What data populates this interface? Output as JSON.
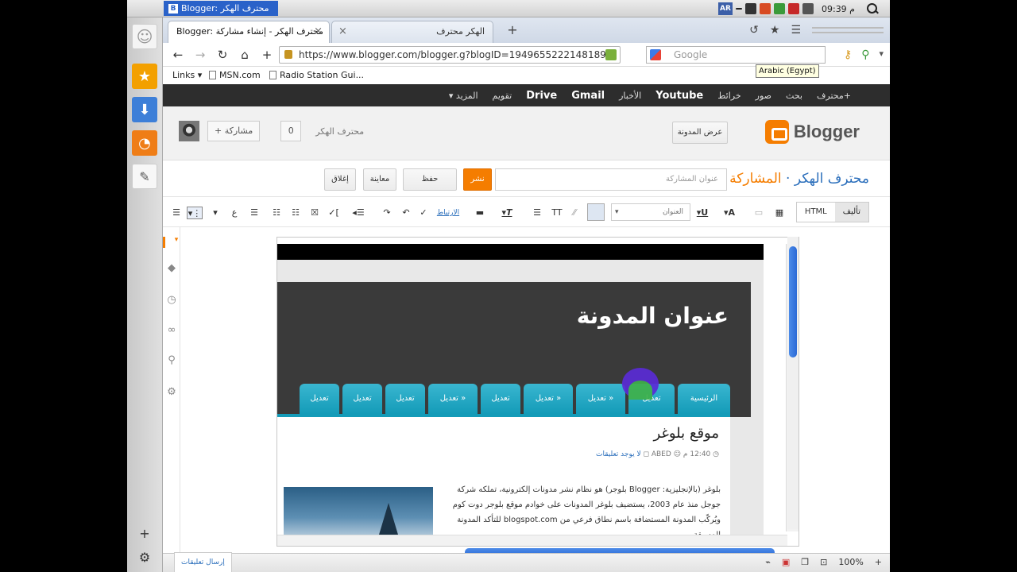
{
  "system": {
    "active_app_title": "Blogger: محترف الهكر ...",
    "language_indicator": "AR",
    "time": "م 09:39"
  },
  "launcher": {
    "icons": [
      "smiley-icon",
      "star-icon",
      "download-icon",
      "rss-icon",
      "notepad-icon",
      "add-icon",
      "settings-icon"
    ]
  },
  "browser": {
    "tabs": [
      {
        "title": "Blogger: محترف الهكر - إنشاء مشاركة",
        "active": true
      },
      {
        "title": "الهكر محترف",
        "active": false
      }
    ],
    "new_tab_symbol": "+",
    "url": "https://www.blogger.com/blogger.g?blogID=19496552221481899",
    "search_placeholder": "Google",
    "language_tooltip": "Arabic (Egypt)",
    "bookmarks": [
      "Links ▾",
      "MSN.com",
      "Radio Station Gui..."
    ]
  },
  "google_bar": {
    "items": [
      "+محترف",
      "بحث",
      "صور",
      "خرائط",
      "Youtube",
      "الأخبار",
      "Gmail",
      "Drive",
      "تقويم",
      "المزيد ▾"
    ]
  },
  "blogger_header": {
    "logo_text": "Blogger",
    "view_blog_label": "عرض المدونة",
    "account_name": "محترف الهكر",
    "notification_count": "0",
    "share_label": "+ مشاركة"
  },
  "post_editor": {
    "blog_name": "محترف الهكر",
    "separator": " · ",
    "section": "المشاركة",
    "title_placeholder": "عنوان المشاركة",
    "publish_label": "نشر",
    "save_label": "حفظ",
    "preview_label": "معاينة",
    "close_label": "إغلاق",
    "mode_compose": "تأليف",
    "mode_html": "HTML",
    "font_select_value": "العنوان",
    "link_label": "الارتباط"
  },
  "blog_preview": {
    "blog_title": "عنوان المدونة",
    "menu_items": [
      "الرئيسية",
      "تعديل",
      "تعديل »",
      "تعديل »",
      "تعديل",
      "تعديل »",
      "تعديل",
      "تعديل",
      "تعديل",
      "تعديل"
    ],
    "post_title": "موقع بلوغر",
    "post_time": "12:40 م",
    "post_author": "ABED",
    "post_comments": "لا يوجد تعليقات",
    "post_body_lines": [
      "بلوغر (بالإنجليزية: Blogger بلوجر) هو نظام نشر مدونات إلكترونية، تملكه شركة",
      "جوجل منذ عام 2003، يستضيف بلوغر المدونات على خوادم موقع بلوجر دوت كوم",
      "ويُركّب المدونة المستضافة باسم نطاق فرعي من blogspot.com للتأكد المدونة المسبقة"
    ]
  },
  "statusbar": {
    "send_feedback_label": "إرسال تعليقات",
    "zoom": "100%"
  }
}
